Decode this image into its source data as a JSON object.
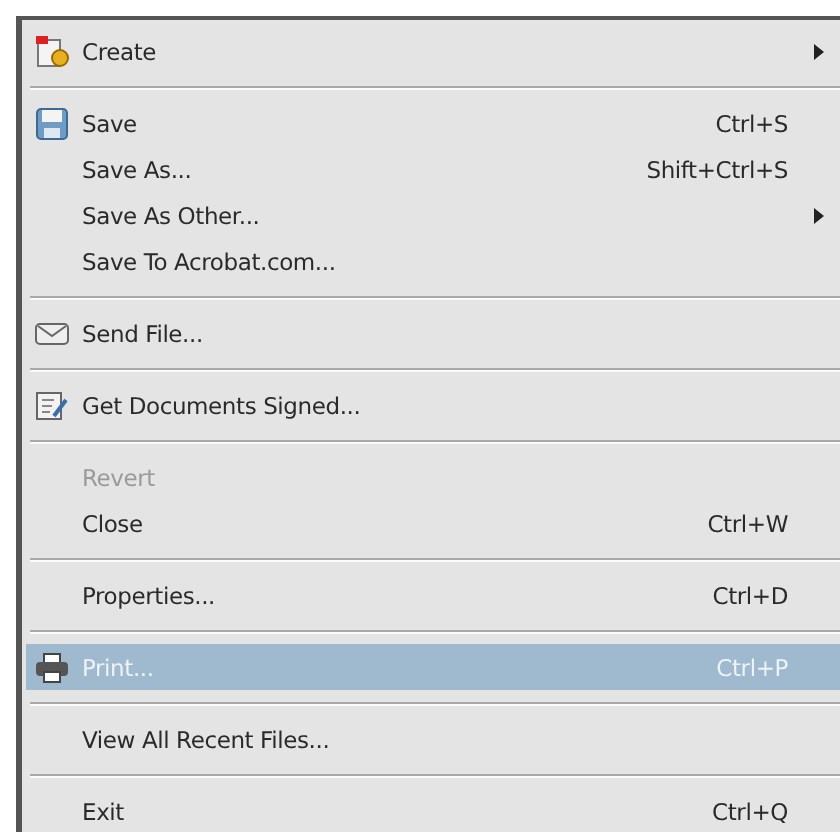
{
  "menu": {
    "groups": [
      {
        "items": [
          {
            "label": "Create",
            "submenu": true,
            "disabled": false,
            "selected": false
          }
        ]
      },
      {
        "items": [
          {
            "label": "Save",
            "shortcut": "Ctrl+S",
            "submenu": false,
            "disabled": false,
            "selected": false
          },
          {
            "label": "Save As...",
            "shortcut": "Shift+Ctrl+S",
            "submenu": false,
            "disabled": false,
            "selected": false
          },
          {
            "label": "Save As Other...",
            "submenu": true,
            "disabled": false,
            "selected": false
          },
          {
            "label": "Save To Acrobat.com...",
            "submenu": false,
            "disabled": false,
            "selected": false
          }
        ]
      },
      {
        "items": [
          {
            "label": "Send File...",
            "submenu": false,
            "disabled": false,
            "selected": false
          }
        ]
      },
      {
        "items": [
          {
            "label": "Get Documents Signed...",
            "submenu": false,
            "disabled": false,
            "selected": false
          }
        ]
      },
      {
        "items": [
          {
            "label": "Revert",
            "submenu": false,
            "disabled": true,
            "selected": false
          },
          {
            "label": "Close",
            "shortcut": "Ctrl+W",
            "submenu": false,
            "disabled": false,
            "selected": false
          }
        ]
      },
      {
        "items": [
          {
            "label": "Properties...",
            "shortcut": "Ctrl+D",
            "submenu": false,
            "disabled": false,
            "selected": false
          }
        ]
      },
      {
        "items": [
          {
            "label": "Print...",
            "shortcut": "Ctrl+P",
            "submenu": false,
            "disabled": false,
            "selected": true
          }
        ]
      },
      {
        "items": [
          {
            "label": "View All Recent Files...",
            "submenu": false,
            "disabled": false,
            "selected": false
          }
        ]
      },
      {
        "items": [
          {
            "label": "Exit",
            "shortcut": "Ctrl+Q",
            "submenu": false,
            "disabled": false,
            "selected": false
          }
        ]
      }
    ]
  }
}
